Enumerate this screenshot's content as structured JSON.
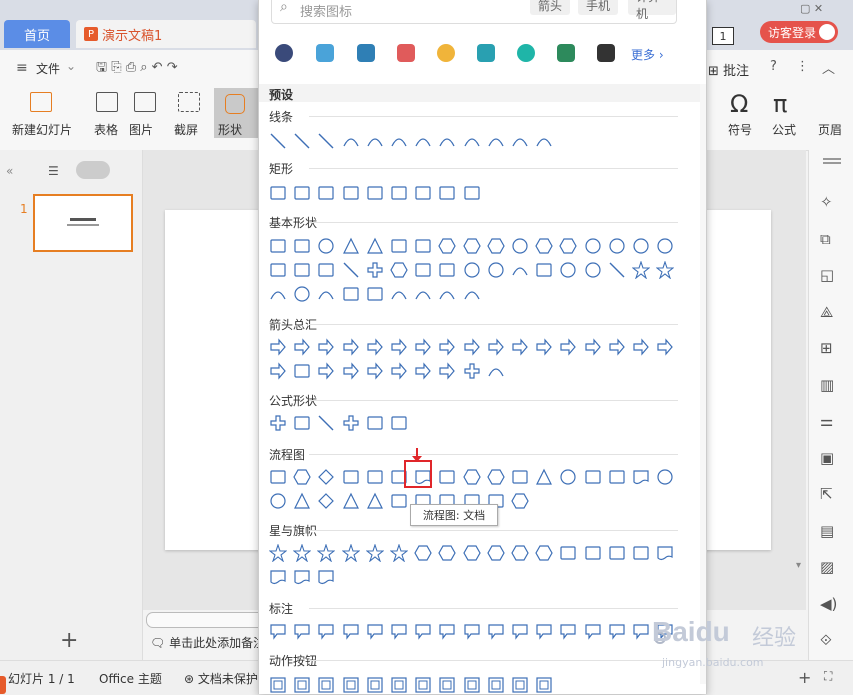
{
  "tabs": {
    "home": "首页",
    "doc": "演示文稿1",
    "doc_logo": "P"
  },
  "top_right": {
    "badge": "1",
    "login": "访客登录"
  },
  "menu": {
    "file": "文件"
  },
  "ribbon": {
    "new_slide": "新建幻灯片",
    "table": "表格",
    "picture": "图片",
    "screenshot": "截屏",
    "shape": "形状",
    "comment": "批注",
    "symbol": "符号",
    "formula": "公式",
    "header": "页眉"
  },
  "left_panel": {
    "slide_num": "1",
    "add": "+"
  },
  "status": {
    "slides": "幻灯片 1 / 1",
    "theme": "Office 主题",
    "doc_state": "文档未保护",
    "notes": "单击此处添加备注"
  },
  "panel": {
    "search_placeholder": "搜索图标",
    "chips": [
      "箭头",
      "手机",
      "计算机"
    ],
    "more": "更多",
    "preset": "预设",
    "sections": [
      "线条",
      "矩形",
      "基本形状",
      "箭头总汇",
      "公式形状",
      "流程图",
      "星与旗帜",
      "标注",
      "动作按钮"
    ],
    "tooltip": "流程图: 文档"
  },
  "colors": {
    "accent_red": "#e0262a",
    "tab_blue": "#5b8de6",
    "login_red": "#e5534b",
    "icon_blue": "#3d6fb6"
  },
  "watermark": {
    "brand": "Baidu",
    "brand_cn": "经验",
    "url": "jingyan.baidu.com"
  }
}
